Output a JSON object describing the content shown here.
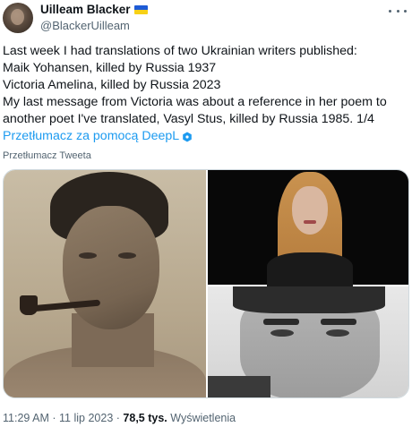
{
  "author": {
    "display_name": "Uilleam Blacker",
    "handle": "@BlackerUilleam",
    "flag_icon": "ukraine-flag-icon",
    "flag_colors": [
      "#1d5bd6",
      "#f7d117"
    ]
  },
  "tweet": {
    "lines": [
      "Last week I had translations of two Ukrainian writers published:",
      "Maik Yohansen, killed by Russia 1937",
      "Victoria Amelina, killed by Russia 2023",
      "My last message from Victoria was about a reference in her poem to",
      "another poet I've translated, Vasyl Stus, killed by Russia 1985. 1/4"
    ],
    "translate_link": "Przetłumacz za pomocą DeepL",
    "translated_by_note": "Przetłumacz Tweeta"
  },
  "meta": {
    "time": "11:29 AM",
    "separator": "·",
    "date": "11 lip 2023",
    "views_count": "78,5 tys.",
    "views_label": "Wyświetlenia"
  },
  "colors": {
    "link": "#1d9bf0",
    "secondary_text": "#536471",
    "primary_text": "#0f1419"
  }
}
